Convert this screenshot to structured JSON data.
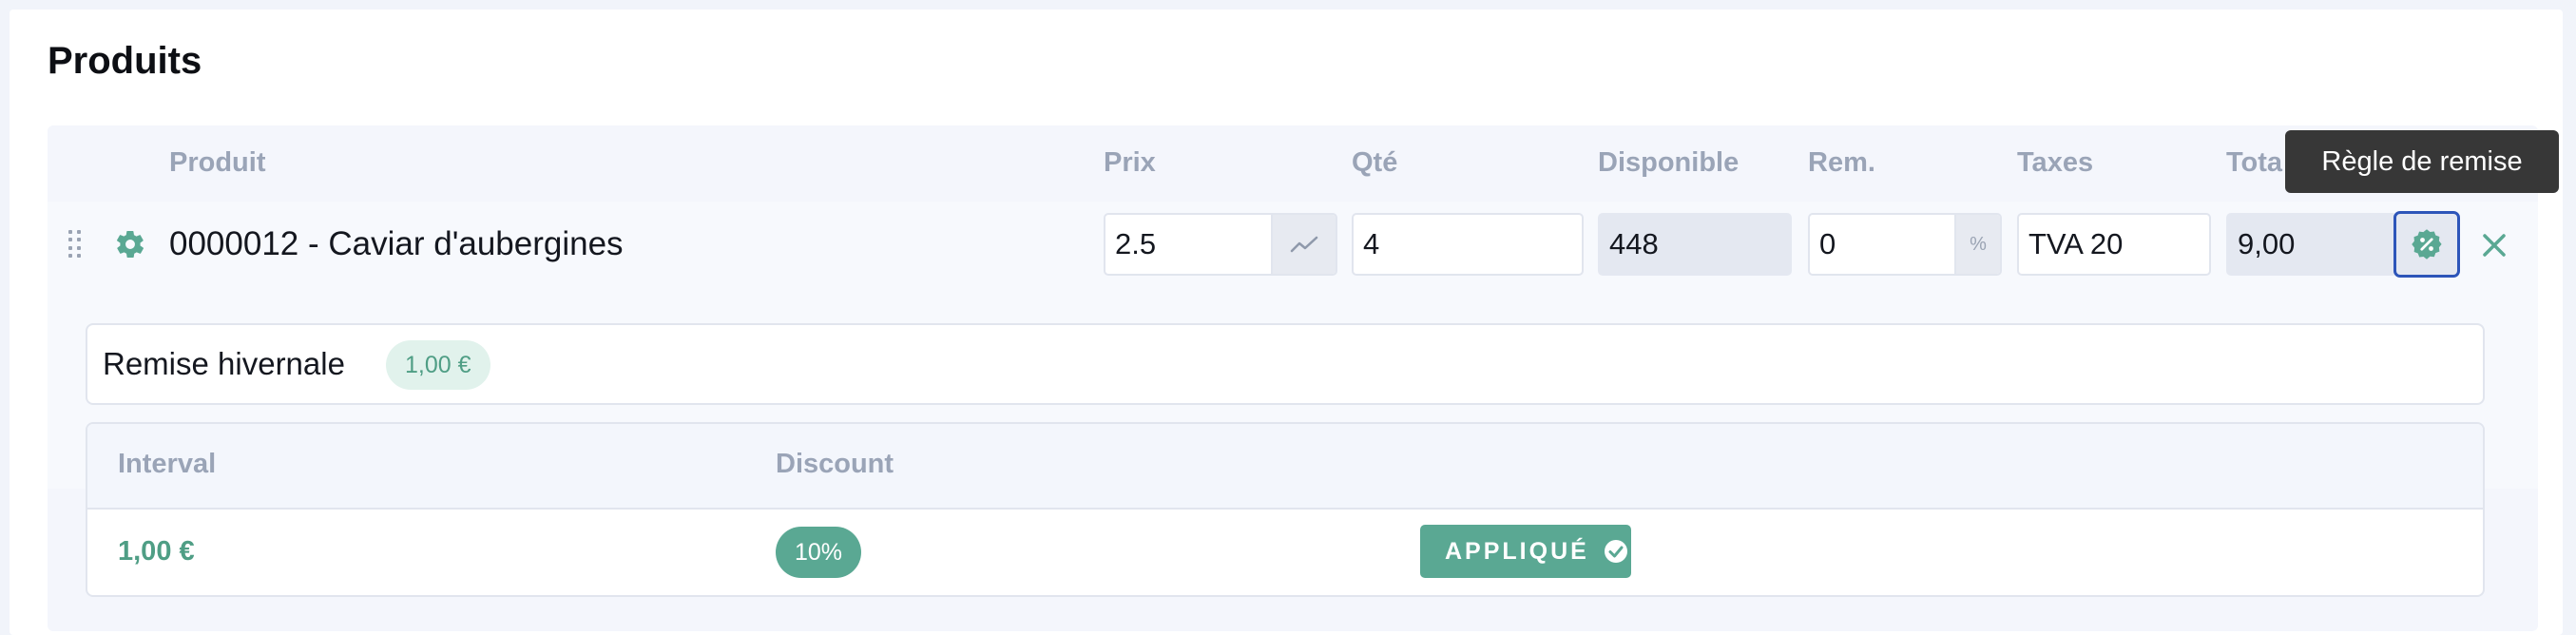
{
  "section": {
    "title": "Produits"
  },
  "columns": {
    "product": "Produit",
    "price": "Prix",
    "qty": "Qté",
    "available": "Disponible",
    "discount": "Rem.",
    "taxes": "Taxes",
    "total": "Tota"
  },
  "line": {
    "product_name": "0000012 - Caviar d'aubergines",
    "price": "2.5",
    "qty": "4",
    "available": "448",
    "discount": "0",
    "discount_unit": "%",
    "tax": "TVA 20",
    "total": "9,00"
  },
  "tooltip": {
    "text": "Règle de remise"
  },
  "discount_rule": {
    "name": "Remise hivernale",
    "amount": "1,00 €",
    "table": {
      "headers": [
        "Interval",
        "Discount"
      ],
      "rows": [
        {
          "interval": "1,00 €",
          "discount": "10%",
          "status": "APPLIQUÉ"
        }
      ]
    }
  },
  "colors": {
    "accent": "#5aa893",
    "focus": "#2d55b9",
    "header_text": "#9aa4b7"
  },
  "icons": [
    "drag-handle-icon",
    "gear-icon",
    "trend-chart-icon",
    "discount-badge-icon",
    "close-icon",
    "check-circle-icon"
  ]
}
